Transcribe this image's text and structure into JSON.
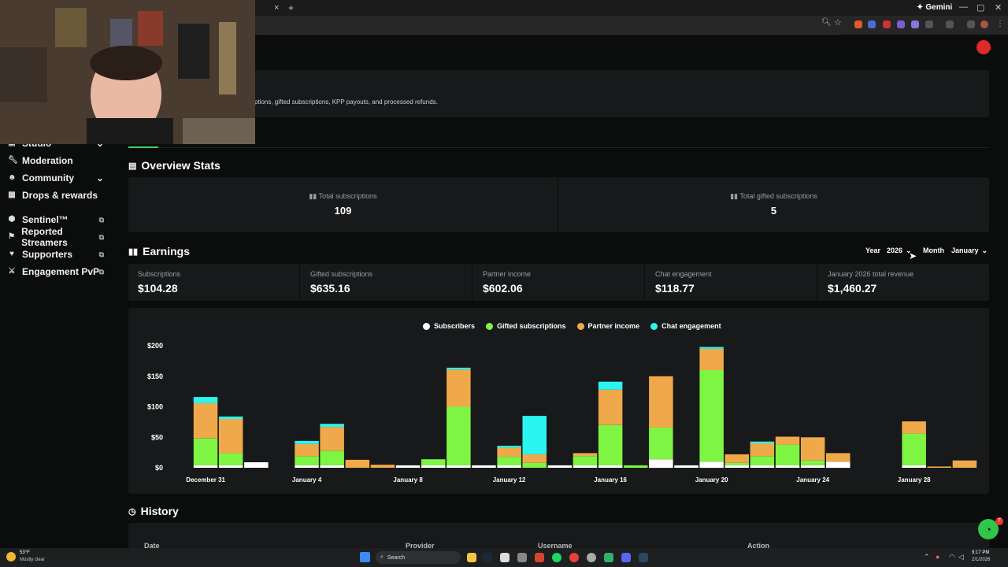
{
  "browser": {
    "gemini_label": "Gemini",
    "new_tab_symbol": "+",
    "close_tab_symbol": "×",
    "window_controls": [
      "—",
      "▢",
      "✕"
    ]
  },
  "page": {
    "description_fragment": "ptions, gifted subscriptions, KPP payouts, and processed refunds."
  },
  "sidebar": {
    "items": [
      {
        "label": "Studio",
        "icon": "studio-icon",
        "trailing": "chevron-down-icon"
      },
      {
        "label": "Moderation",
        "icon": "wrench-icon"
      },
      {
        "label": "Community",
        "icon": "people-icon",
        "trailing": "chevron-down-icon"
      },
      {
        "label": "Drops & rewards",
        "icon": "gift-icon"
      },
      {
        "label": "Sentinel™",
        "icon": "shield-icon",
        "trailing": "external-link-icon"
      },
      {
        "label": "Reported Streamers",
        "icon": "flag-icon",
        "trailing": "external-link-icon"
      },
      {
        "label": "Supporters",
        "icon": "heart-icon",
        "trailing": "external-link-icon"
      },
      {
        "label": "Engagement PvP",
        "icon": "swords-icon",
        "trailing": "external-link-icon"
      }
    ]
  },
  "overview": {
    "title": "Overview Stats",
    "stats": [
      {
        "label": "Total subscriptions",
        "value": "109"
      },
      {
        "label": "Total gifted subscriptions",
        "value": "5"
      }
    ]
  },
  "earnings": {
    "title": "Earnings",
    "year_label": "Year",
    "year_value": "2026",
    "month_label": "Month",
    "month_value": "January",
    "cells": [
      {
        "label": "Subscriptions",
        "value": "$104.28"
      },
      {
        "label": "Gifted subscriptions",
        "value": "$635.16"
      },
      {
        "label": "Partner income",
        "value": "$602.06"
      },
      {
        "label": "Chat engagement",
        "value": "$118.77"
      },
      {
        "label": "January 2026 total revenue",
        "value": "$1,460.27"
      }
    ]
  },
  "chart_data": {
    "type": "bar",
    "stacked": true,
    "ylim": [
      0,
      200
    ],
    "yticks": [
      "$200",
      "$150",
      "$100",
      "$50",
      "$0"
    ],
    "ytick_values": [
      200,
      150,
      100,
      50,
      0
    ],
    "xtick_labels": [
      "December 31",
      "January 4",
      "January 8",
      "January 12",
      "January 16",
      "January 20",
      "January 24",
      "January 28"
    ],
    "xtick_indices": [
      0,
      4,
      8,
      12,
      16,
      20,
      24,
      28
    ],
    "categories": [
      "Dec 31",
      "Jan 1",
      "Jan 2",
      "Jan 3",
      "Jan 4",
      "Jan 5",
      "Jan 6",
      "Jan 7",
      "Jan 8",
      "Jan 9",
      "Jan 10",
      "Jan 11",
      "Jan 12",
      "Jan 13",
      "Jan 14",
      "Jan 15",
      "Jan 16",
      "Jan 17",
      "Jan 18",
      "Jan 19",
      "Jan 20",
      "Jan 21",
      "Jan 22",
      "Jan 23",
      "Jan 24",
      "Jan 25",
      "Jan 26",
      "Jan 27",
      "Jan 28",
      "Jan 29",
      "Jan 30"
    ],
    "series": [
      {
        "name": "Subscribers",
        "color": "#ffffff",
        "values": [
          4,
          4,
          9,
          0,
          4,
          4,
          0,
          0,
          4,
          4,
          4,
          4,
          4,
          0,
          4,
          4,
          4,
          0,
          14,
          4,
          10,
          4,
          4,
          4,
          4,
          10,
          0,
          0,
          4,
          0,
          0
        ]
      },
      {
        "name": "Gifted subscriptions",
        "color": "#7ef542",
        "values": [
          44,
          20,
          0,
          0,
          15,
          24,
          0,
          0,
          0,
          10,
          96,
          0,
          14,
          8,
          0,
          15,
          66,
          4,
          52,
          0,
          150,
          4,
          15,
          34,
          8,
          0,
          0,
          0,
          52,
          0,
          0
        ]
      },
      {
        "name": "Partner income",
        "color": "#f0a94a",
        "values": [
          58,
          56,
          0,
          0,
          20,
          39,
          13,
          5,
          0,
          0,
          61,
          0,
          15,
          14,
          0,
          5,
          58,
          0,
          84,
          0,
          35,
          14,
          21,
          13,
          38,
          14,
          0,
          0,
          20,
          2,
          12
        ]
      },
      {
        "name": "Chat engagement",
        "color": "#2af5f0",
        "values": [
          10,
          4,
          0,
          0,
          5,
          5,
          0,
          0,
          0,
          0,
          3,
          0,
          3,
          63,
          0,
          0,
          13,
          0,
          0,
          0,
          3,
          0,
          3,
          0,
          0,
          0,
          0,
          0,
          0,
          0,
          0
        ]
      }
    ]
  },
  "history": {
    "title": "History",
    "columns": [
      "Date",
      "Provider",
      "Username",
      "Action"
    ]
  },
  "taskbar": {
    "weather_temp": "53°F",
    "weather_desc": "Mostly clear",
    "search_label": "Search",
    "time": "9:17 PM",
    "date": "2/1/2026",
    "notification_count": "7"
  }
}
